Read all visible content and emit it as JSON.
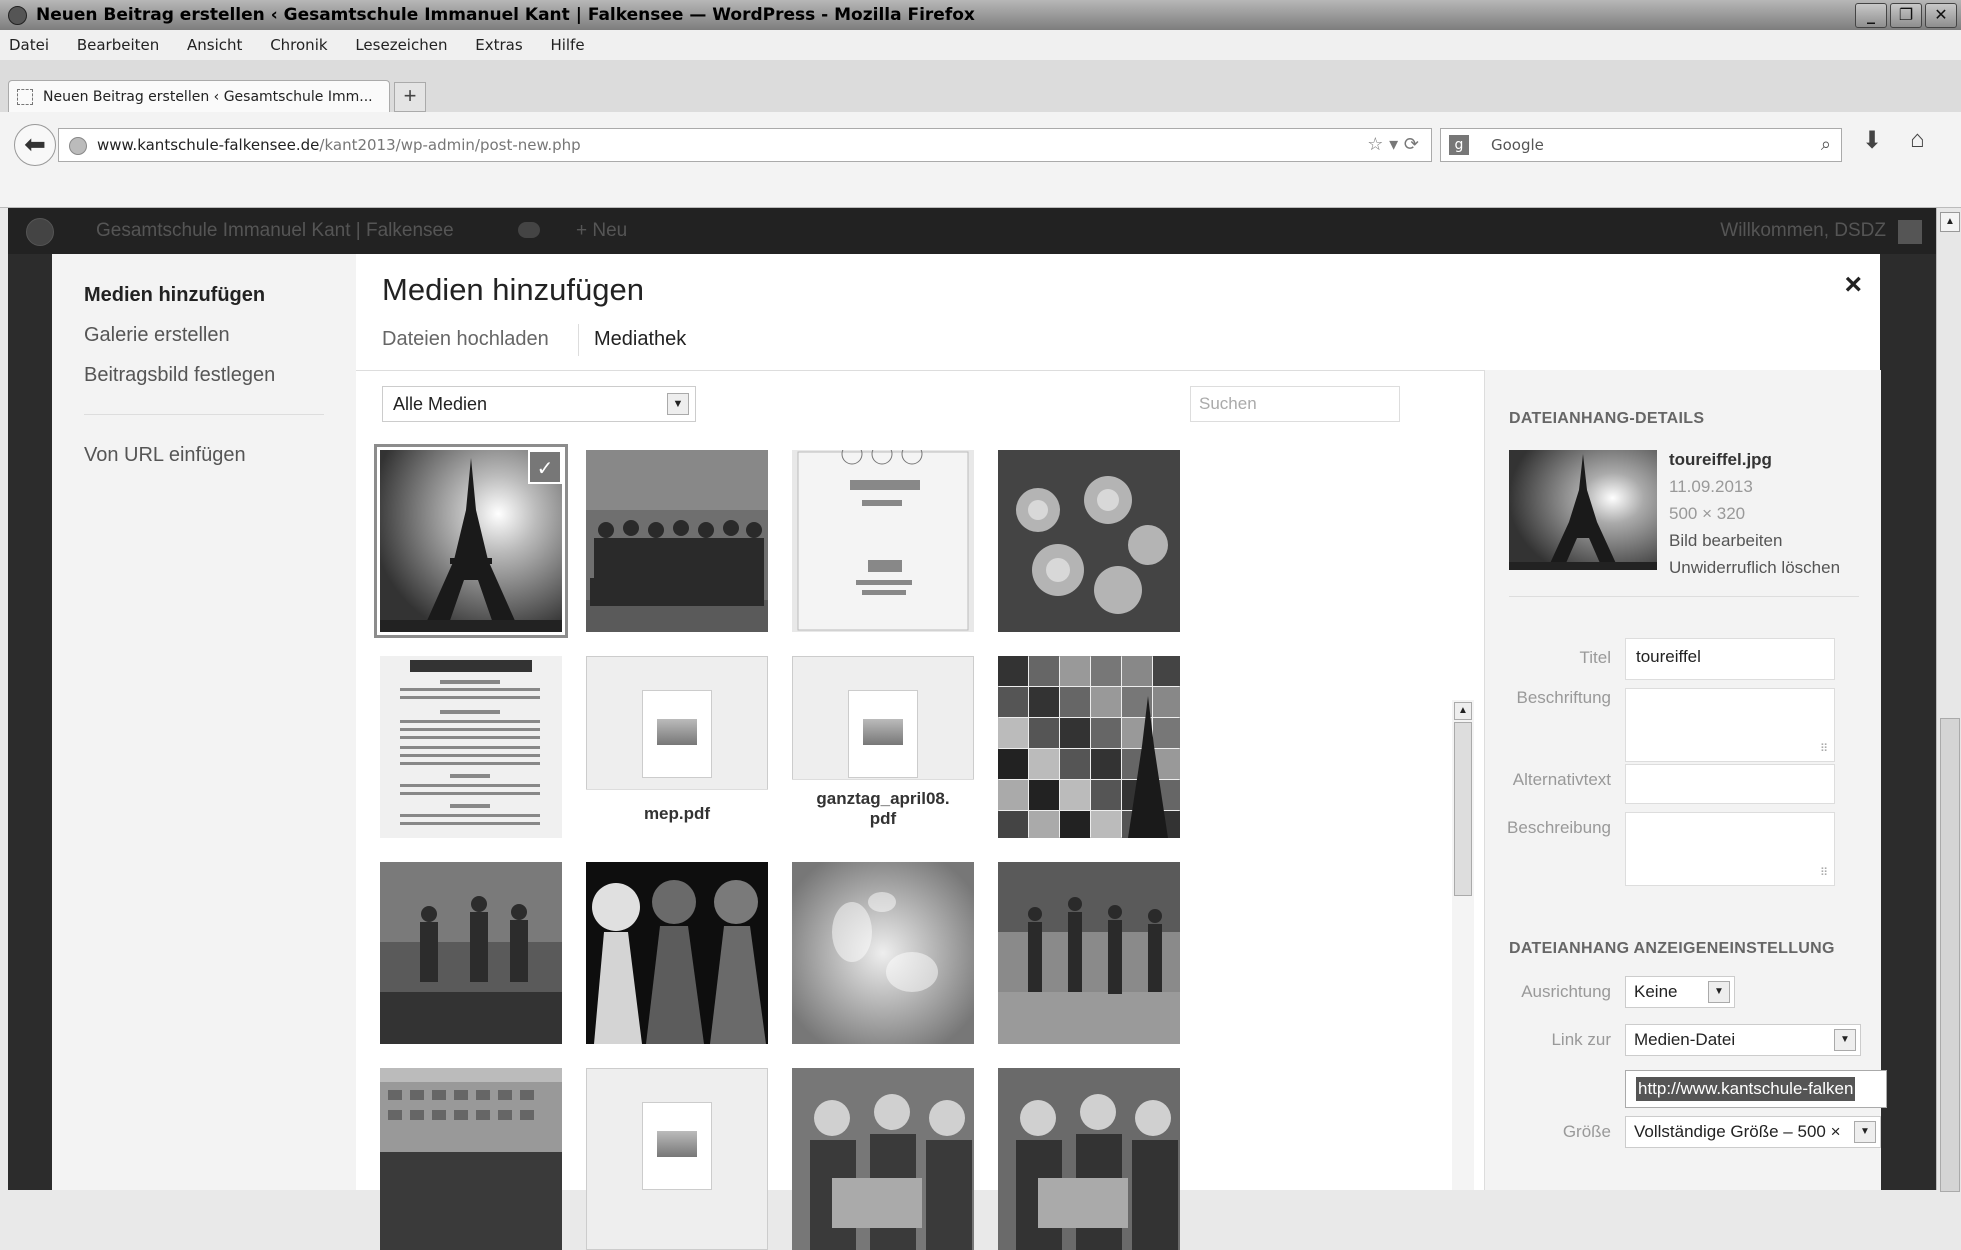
{
  "window": {
    "title": "Neuen Beitrag erstellen ‹ Gesamtschule Immanuel Kant | Falkensee — WordPress - Mozilla Firefox"
  },
  "menu": [
    "Datei",
    "Bearbeiten",
    "Ansicht",
    "Chronik",
    "Lesezeichen",
    "Extras",
    "Hilfe"
  ],
  "tab": {
    "title": "Neuen Beitrag erstellen ‹ Gesamtschule Imm...",
    "new_tab": "+"
  },
  "nav": {
    "url_domain": "www.kantschule-falkensee.de",
    "url_path": "/kant2013/wp-admin/post-new.php",
    "search_placeholder": "Google",
    "search_engine": "g"
  },
  "adminbar": {
    "site": "Gesamtschule Immanuel Kant | Falkensee",
    "new": "+ Neu",
    "welcome": "Willkommen, DSDZ"
  },
  "modal": {
    "menu": [
      "Medien hinzufügen",
      "Galerie erstellen",
      "Beitragsbild festlegen",
      "Von URL einfügen"
    ],
    "title": "Medien hinzufügen",
    "close": "×",
    "routers": [
      "Dateien hochladen",
      "Mediathek"
    ],
    "filter": "Alle Medien",
    "search_placeholder": "Suchen",
    "attachments": [
      {
        "kind": "image",
        "desc": "eiffel"
      },
      {
        "kind": "image",
        "desc": "team"
      },
      {
        "kind": "image",
        "desc": "certificate"
      },
      {
        "kind": "image",
        "desc": "roses"
      },
      {
        "kind": "image",
        "desc": "menu"
      },
      {
        "kind": "pdf",
        "label": "mep.pdf"
      },
      {
        "kind": "pdf",
        "label": "ganztag_april08.\npdf"
      },
      {
        "kind": "image",
        "desc": "collage"
      },
      {
        "kind": "image",
        "desc": "concert"
      },
      {
        "kind": "image",
        "desc": "pawns"
      },
      {
        "kind": "image",
        "desc": "blur"
      },
      {
        "kind": "image",
        "desc": "dance"
      },
      {
        "kind": "image",
        "desc": "school"
      },
      {
        "kind": "pdf",
        "label": ""
      },
      {
        "kind": "image",
        "desc": "boys1"
      },
      {
        "kind": "image",
        "desc": "boys2"
      }
    ]
  },
  "details": {
    "heading": "DATEIANHANG-DETAILS",
    "filename": "toureiffel.jpg",
    "date": "11.09.2013",
    "dimensions": "500 × 320",
    "edit": "Bild bearbeiten",
    "delete": "Unwiderruflich löschen",
    "fields": {
      "title_label": "Titel",
      "title_value": "toureiffel",
      "caption_label": "Beschriftung",
      "alt_label": "Alternativtext",
      "desc_label": "Beschreibung"
    },
    "display_heading": "DATEIANHANG ANZEIGENEINSTELLUNG",
    "align_label": "Ausrichtung",
    "align_value": "Keine",
    "link_label": "Link zur",
    "link_value": "Medien-Datei",
    "link_url": "http://www.kantschule-falken",
    "size_label": "Größe",
    "size_value": "Vollständige Größe – 500 ×"
  }
}
